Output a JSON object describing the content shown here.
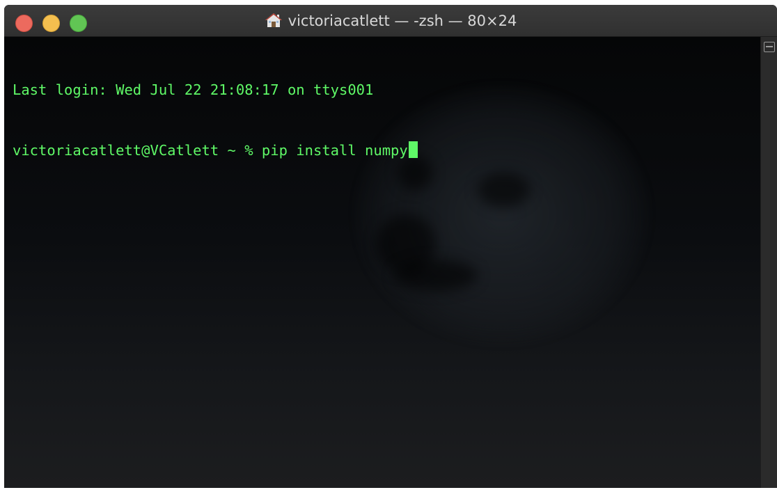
{
  "window": {
    "title": "victoriacatlett — -zsh — 80×24",
    "title_icon": "home-icon",
    "traffic_lights": {
      "close_color": "#ec6a5e",
      "minimize_color": "#f4bf4f",
      "zoom_color": "#61c554"
    }
  },
  "terminal": {
    "text_color": "#5ff967",
    "lines": [
      "Last login: Wed Jul 22 21:08:17 on ttys001",
      "victoriacatlett@VCatlett ~ % pip install numpy"
    ]
  },
  "scrollbar": {
    "icon": "split-pane-icon"
  }
}
